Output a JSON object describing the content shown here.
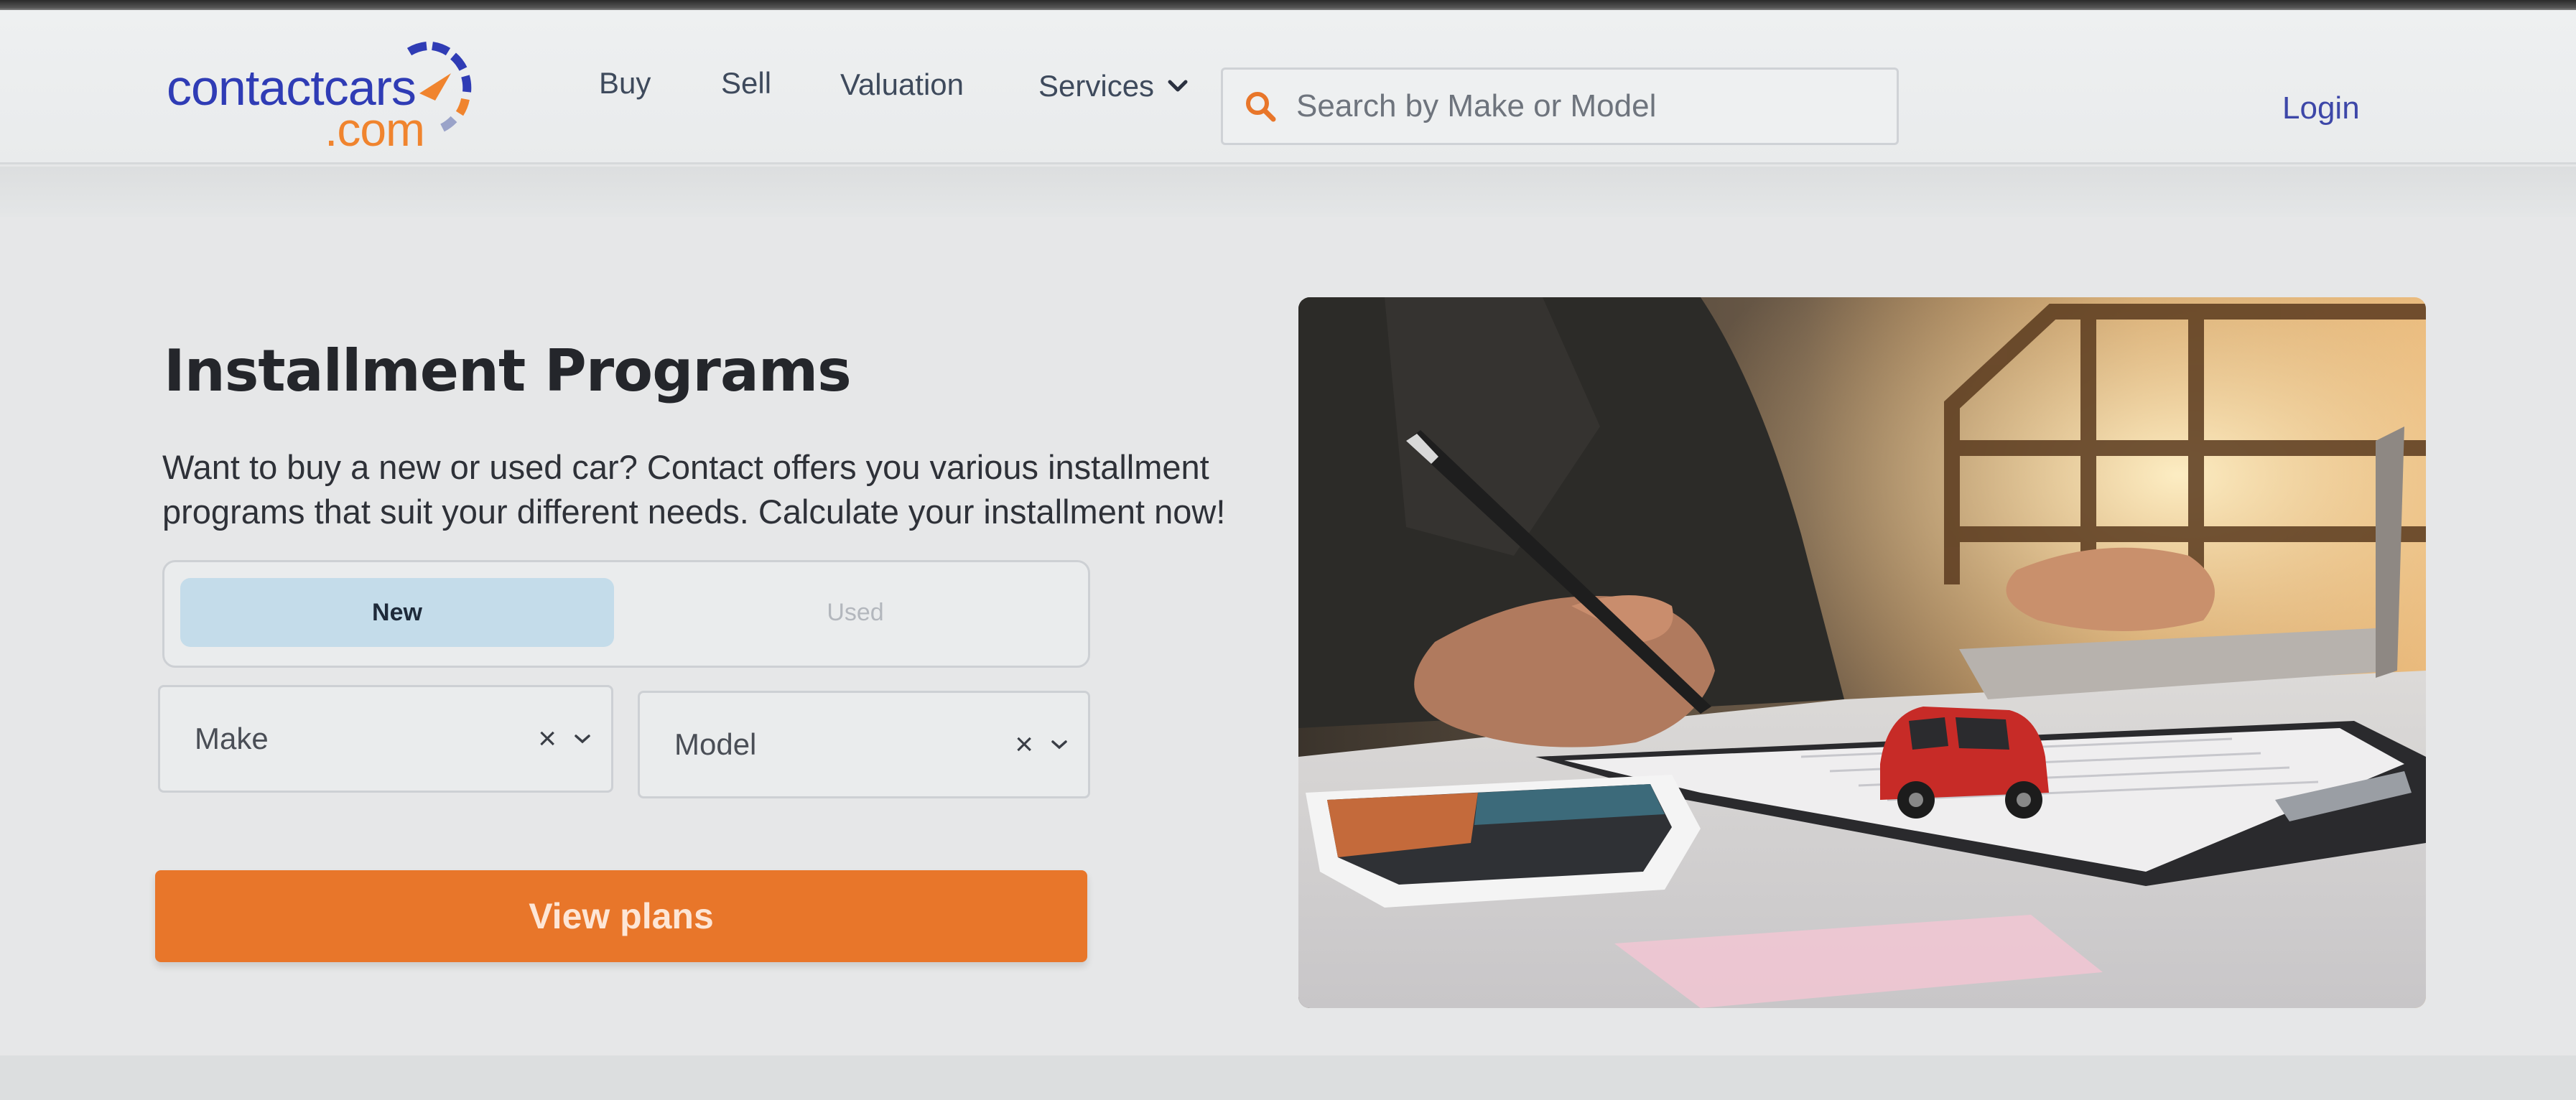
{
  "brand": {
    "logo_main": "contactcars",
    "logo_sub": ".com",
    "primary_color": "#2f3cb5",
    "accent_color": "#f0842e"
  },
  "nav": {
    "buy": "Buy",
    "sell": "Sell",
    "valuation": "Valuation",
    "services": "Services"
  },
  "search": {
    "placeholder": "Search by Make or Model",
    "icon": "search-icon"
  },
  "header": {
    "login": "Login"
  },
  "main": {
    "title": "Installment Programs",
    "description": "Want to buy a new or used car? Contact offers you various installment programs that suit your different needs. Calculate your installment now!",
    "condition_toggle": {
      "new_label": "New",
      "used_label": "Used",
      "selected": "New"
    },
    "make_select": {
      "placeholder": "Make"
    },
    "model_select": {
      "placeholder": "Model"
    },
    "cta_label": "View plans",
    "cta_color": "#e8762a"
  },
  "hero_image": {
    "subject": "person signing contract with toy red car on clipboard"
  }
}
